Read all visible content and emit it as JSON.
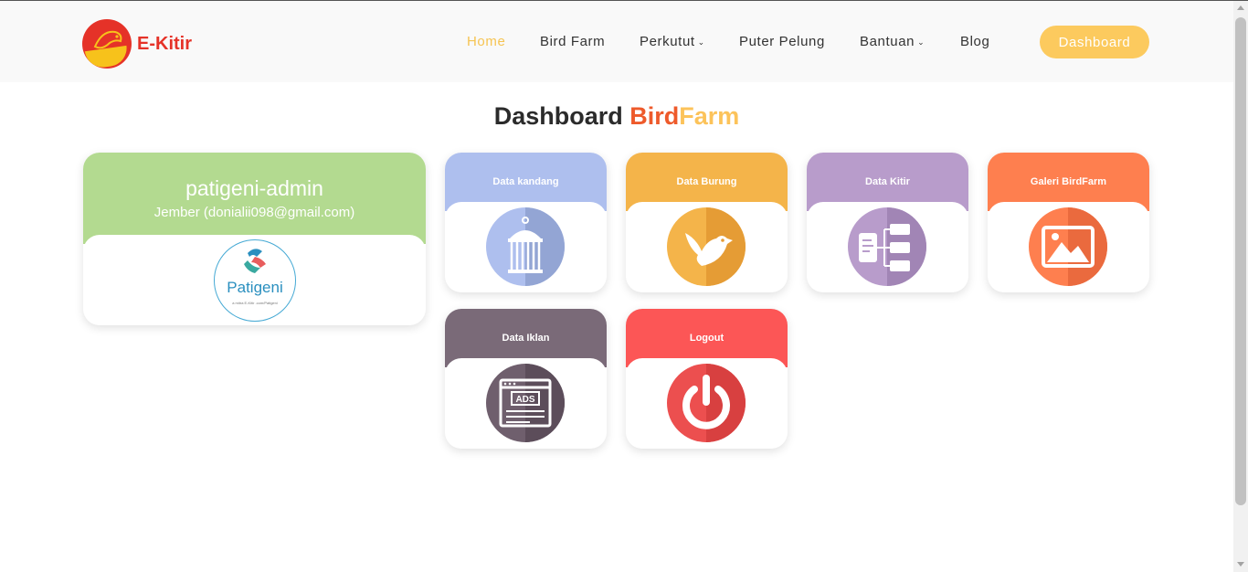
{
  "brand": {
    "name": "E-Kitir"
  },
  "nav": {
    "items": [
      {
        "label": "Home",
        "has_dropdown": false,
        "active": true
      },
      {
        "label": "Bird Farm",
        "has_dropdown": false,
        "active": false
      },
      {
        "label": "Perkutut",
        "has_dropdown": true,
        "active": false
      },
      {
        "label": "Puter Pelung",
        "has_dropdown": false,
        "active": false
      },
      {
        "label": "Bantuan",
        "has_dropdown": true,
        "active": false
      },
      {
        "label": "Blog",
        "has_dropdown": false,
        "active": false
      }
    ],
    "dropdown_icon": "chevron-down-icon",
    "cta_label": "Dashboard"
  },
  "page_title": {
    "part1": "Dashboard",
    "part2": "Bird",
    "part3": "Farm"
  },
  "profile": {
    "name": "patigeni-admin",
    "subtitle": "Jember (donialii098@gmail.com)",
    "logo_text": "Patigeni",
    "logo_small": "a mitra E-Kitir .com/Patigeni"
  },
  "tiles": [
    {
      "label": "Data kandang",
      "icon": "birdcage-icon",
      "color": "#aebfee"
    },
    {
      "label": "Data Burung",
      "icon": "bird-icon",
      "color": "#f4b44a"
    },
    {
      "label": "Data Kitir",
      "icon": "document-tree-icon",
      "color": "#b89ccb"
    },
    {
      "label": "Galeri BirdFarm",
      "icon": "image-gallery-icon",
      "color": "#fe7f4f"
    },
    {
      "label": "Data Iklan",
      "icon": "ads-icon",
      "color": "#7a6a78"
    },
    {
      "label": "Logout",
      "icon": "power-icon",
      "color": "#fc5656"
    }
  ],
  "colors": {
    "accent_yellow": "#fcca5e",
    "accent_orange": "#ee5a2b",
    "profile_green": "#b3da90",
    "logo_red": "#e53228"
  }
}
